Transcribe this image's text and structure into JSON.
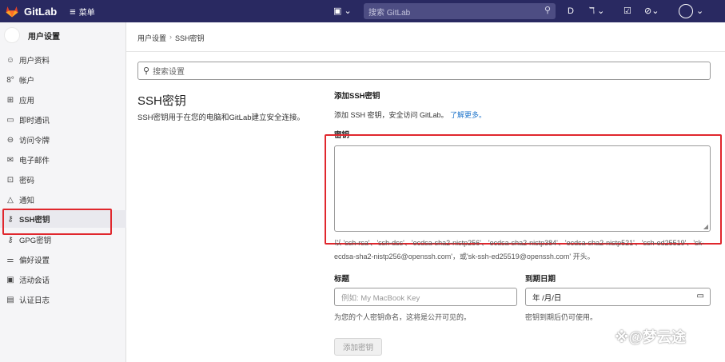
{
  "topbar": {
    "logo_text": "GitLab",
    "menu_label": "菜单",
    "search_placeholder": "搜索 GitLab",
    "icons": [
      "plus-square-icon",
      "search-icon",
      "issues-icon",
      "merge-request-icon",
      "todo-icon",
      "help-icon",
      "user-avatar"
    ]
  },
  "sidebar": {
    "title": "用户设置",
    "items": [
      {
        "label": "用户资料",
        "icon": "user-profile-icon"
      },
      {
        "label": "帐户",
        "icon": "account-icon"
      },
      {
        "label": "应用",
        "icon": "applications-icon"
      },
      {
        "label": "即时通讯",
        "icon": "chat-icon"
      },
      {
        "label": "访问令牌",
        "icon": "token-icon"
      },
      {
        "label": "电子邮件",
        "icon": "email-icon"
      },
      {
        "label": "密码",
        "icon": "lock-icon"
      },
      {
        "label": "通知",
        "icon": "bell-icon"
      },
      {
        "label": "SSH密钥",
        "icon": "key-icon"
      },
      {
        "label": "GPG密钥",
        "icon": "key-icon"
      },
      {
        "label": "偏好设置",
        "icon": "preferences-icon"
      },
      {
        "label": "活动会话",
        "icon": "monitor-icon"
      },
      {
        "label": "认证日志",
        "icon": "log-icon"
      }
    ],
    "active_index": 8
  },
  "breadcrumb": {
    "items": [
      "用户设置",
      "SSH密钥"
    ],
    "separator": "›"
  },
  "settings_search": {
    "placeholder": "搜索设置"
  },
  "ssh_section": {
    "title": "SSH密钥",
    "description": "SSH密钥用于在您的电脑和GitLab建立安全连接。"
  },
  "add_form": {
    "title": "添加SSH密钥",
    "description": "添加 SSH 密钥，安全访问 GitLab。",
    "learn_more": "了解更多。",
    "key_label": "密钥",
    "key_value": "",
    "key_help": "以 'ssh-rsa'、'ssh-dss'、'ecdsa-sha2-nistp256'、'ecdsa-sha2-nistp384'、'ecdsa-sha2-nistp521'、'ssh-ed25519'、'sk-ecdsa-sha2-nistp256@openssh.com'，或'sk-ssh-ed25519@openssh.com' 开头。",
    "title_label": "标题",
    "title_placeholder": "例如: My MacBook Key",
    "title_help": "为您的个人密钥命名，这将是公开可见的。",
    "expires_label": "到期日期",
    "expires_value": "年 /月/日",
    "expires_help": "密钥到期后仍可使用。",
    "submit_label": "添加密钥"
  },
  "watermark": "※@梦云途",
  "colors": {
    "topbar": "#292961",
    "highlight": "#e0272d",
    "link": "#1f75cb"
  }
}
